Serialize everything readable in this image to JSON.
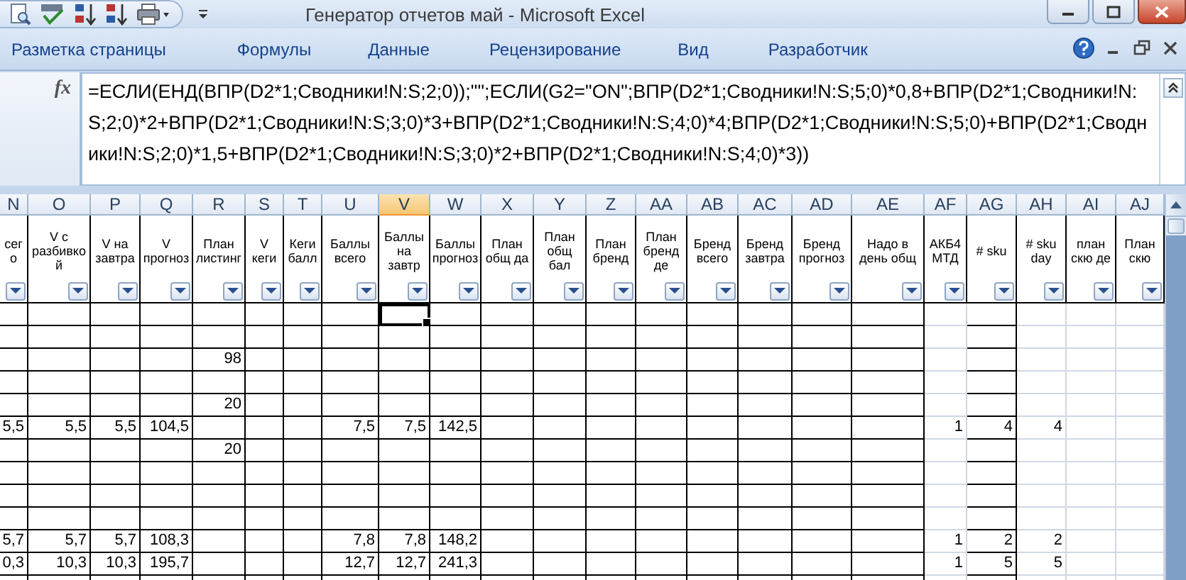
{
  "window": {
    "title": "Генератор отчетов май - Microsoft Excel"
  },
  "ribbon_tabs": [
    {
      "label": "Разметка страницы"
    },
    {
      "label": "Формулы"
    },
    {
      "label": "Данные"
    },
    {
      "label": "Рецензирование"
    },
    {
      "label": "Вид"
    },
    {
      "label": "Разработчик"
    }
  ],
  "formula_bar": {
    "fx": "fx",
    "formula": "=ЕСЛИ(ЕНД(ВПР(D2*1;Сводники!N:S;2;0));\"\";ЕСЛИ(G2=\"ON\";ВПР(D2*1;Сводники!N:S;5;0)*0,8+ВПР(D2*1;Сводники!N:S;2;0)*2+ВПР(D2*1;Сводники!N:S;3;0)*3+ВПР(D2*1;Сводники!N:S;4;0)*4;ВПР(D2*1;Сводники!N:S;5;0)+ВПР(D2*1;Сводники!N:S;2;0)*1,5+ВПР(D2*1;Сводники!N:S;3;0)*2+ВПР(D2*1;Сводники!N:S;4;0)*3))"
  },
  "sheet": {
    "columns": [
      {
        "letter": "N",
        "header": "сего",
        "selected": false,
        "kind": "bordered"
      },
      {
        "letter": "O",
        "header": "V с разбивкой",
        "selected": false,
        "kind": "bordered"
      },
      {
        "letter": "P",
        "header": "V на завтра",
        "selected": false,
        "kind": "bordered"
      },
      {
        "letter": "Q",
        "header": "V прогноз",
        "selected": false,
        "kind": "bordered"
      },
      {
        "letter": "R",
        "header": "План листинг",
        "selected": false,
        "kind": "bordered"
      },
      {
        "letter": "S",
        "header": "V кеги",
        "selected": false,
        "kind": "bordered"
      },
      {
        "letter": "T",
        "header": "Кеги балл",
        "selected": false,
        "kind": "bordered"
      },
      {
        "letter": "U",
        "header": "Баллы всего",
        "selected": false,
        "kind": "bordered"
      },
      {
        "letter": "V",
        "header": "Баллы на завтр",
        "selected": true,
        "kind": "bordered"
      },
      {
        "letter": "W",
        "header": "Баллы прогноз",
        "selected": false,
        "kind": "bordered"
      },
      {
        "letter": "X",
        "header": "План общ да",
        "selected": false,
        "kind": "bordered"
      },
      {
        "letter": "Y",
        "header": "План общ бал",
        "selected": false,
        "kind": "bordered"
      },
      {
        "letter": "Z",
        "header": "План бренд",
        "selected": false,
        "kind": "bordered"
      },
      {
        "letter": "AA",
        "header": "План бренд де",
        "selected": false,
        "kind": "bordered"
      },
      {
        "letter": "AB",
        "header": "Бренд всего",
        "selected": false,
        "kind": "bordered"
      },
      {
        "letter": "AC",
        "header": "Бренд завтра",
        "selected": false,
        "kind": "bordered"
      },
      {
        "letter": "AD",
        "header": "Бренд прогноз",
        "selected": false,
        "kind": "bordered"
      },
      {
        "letter": "AE",
        "header": "Надо в день общ",
        "selected": false,
        "kind": "bordered"
      },
      {
        "letter": "AF",
        "header": "АКБ4 МТД",
        "selected": false,
        "kind": "plain"
      },
      {
        "letter": "AG",
        "header": "# sku",
        "selected": false,
        "kind": "bordered"
      },
      {
        "letter": "AH",
        "header": "# sku day",
        "selected": false,
        "kind": "plain"
      },
      {
        "letter": "AI",
        "header": "план скю де",
        "selected": false,
        "kind": "plain"
      },
      {
        "letter": "AJ",
        "header": "План скю",
        "selected": false,
        "kind": "plain"
      }
    ],
    "rows": [
      {
        "cells": [
          null,
          null,
          null,
          null,
          null,
          null,
          null,
          null,
          {
            "selected": true
          }
        ]
      },
      {},
      {
        "cells": [
          null,
          null,
          null,
          null,
          "98"
        ]
      },
      {},
      {
        "cells": [
          null,
          null,
          null,
          null,
          "20"
        ]
      },
      {
        "cells": [
          "5,5",
          "5,5",
          "5,5",
          "104,5",
          null,
          null,
          null,
          "7,5",
          "7,5",
          "142,5",
          null,
          null,
          null,
          null,
          null,
          null,
          null,
          null,
          "1",
          "4",
          "4"
        ]
      },
      {
        "cells": [
          null,
          null,
          null,
          null,
          "20"
        ]
      },
      {},
      {},
      {},
      {
        "cells": [
          "5,7",
          "5,7",
          "5,7",
          "108,3",
          null,
          null,
          null,
          "7,8",
          "7,8",
          "148,2",
          null,
          null,
          null,
          null,
          null,
          null,
          null,
          null,
          "1",
          "2",
          "2"
        ]
      },
      {
        "cells": [
          "0,3",
          "10,3",
          "10,3",
          "195,7",
          null,
          null,
          null,
          "12,7",
          "12,7",
          "241,3",
          null,
          null,
          null,
          null,
          null,
          null,
          null,
          null,
          "1",
          "5",
          "5"
        ]
      },
      {}
    ]
  }
}
